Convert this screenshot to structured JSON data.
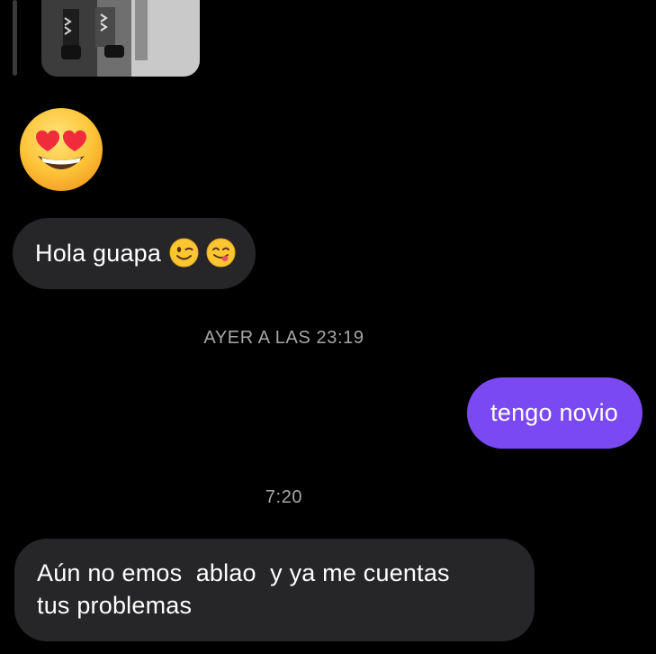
{
  "thread": {
    "shared_photo": {
      "icon": "photo-thumbnail"
    },
    "big_emoji": {
      "icon": "heart-eyes-emoji"
    },
    "messages": [
      {
        "direction": "incoming",
        "text": "Hola guapa",
        "emojis": [
          "winking-face-emoji",
          "face-savoring-food-emoji"
        ]
      },
      {
        "direction": "outgoing",
        "text": "tengo novio"
      },
      {
        "direction": "incoming",
        "lines": [
          "Aún no emos  ablao  y ya me cuentas",
          "tus problemas"
        ]
      }
    ],
    "timestamps": [
      "AYER A LAS 23:19",
      "7:20"
    ]
  },
  "colors": {
    "background": "#000000",
    "incoming_bubble": "#262628",
    "outgoing_bubble": "#7b49f1",
    "timestamp_text": "#a7a7ab"
  }
}
